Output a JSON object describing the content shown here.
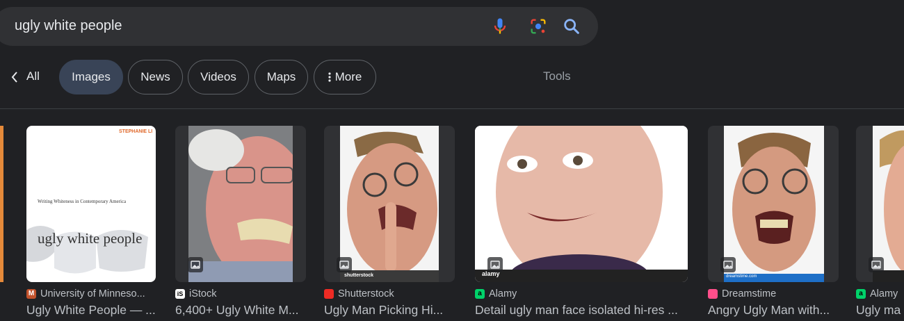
{
  "search": {
    "query": "ugly white people"
  },
  "tabs": {
    "all": "All",
    "images": "Images",
    "news": "News",
    "videos": "Videos",
    "maps": "Maps",
    "more": "More",
    "tools": "Tools"
  },
  "results": [
    {
      "source": "University of Minneso...",
      "title": "Ugly White People — ...",
      "favicon": "M"
    },
    {
      "source": "iStock",
      "title": "6,400+ Ugly White M...",
      "favicon": "iS"
    },
    {
      "source": "Shutterstock",
      "title": "Ugly Man Picking Hi...",
      "favicon": "S"
    },
    {
      "source": "Alamy",
      "title": "Detail ugly man face isolated hi-res ...",
      "favicon": "a"
    },
    {
      "source": "Dreamstime",
      "title": "Angry Ugly Man with...",
      "favicon": "D"
    },
    {
      "source": "Alamy",
      "title": "Ugly ma",
      "favicon": "a"
    }
  ],
  "book_cover": {
    "author": "STEPHANIE LI",
    "subtitle": "Writing Whiteness in Contemporary America",
    "title": "ugly white people"
  },
  "watermarks": {
    "shutterstock": "shutterstock",
    "alamy": "alamy",
    "dreamstime": "dreamstime.com"
  },
  "colors": {
    "background": "#202124",
    "searchbar": "#303134",
    "active_chip": "#394457",
    "text": "#e8eaed",
    "muted": "#9aa0a6"
  }
}
